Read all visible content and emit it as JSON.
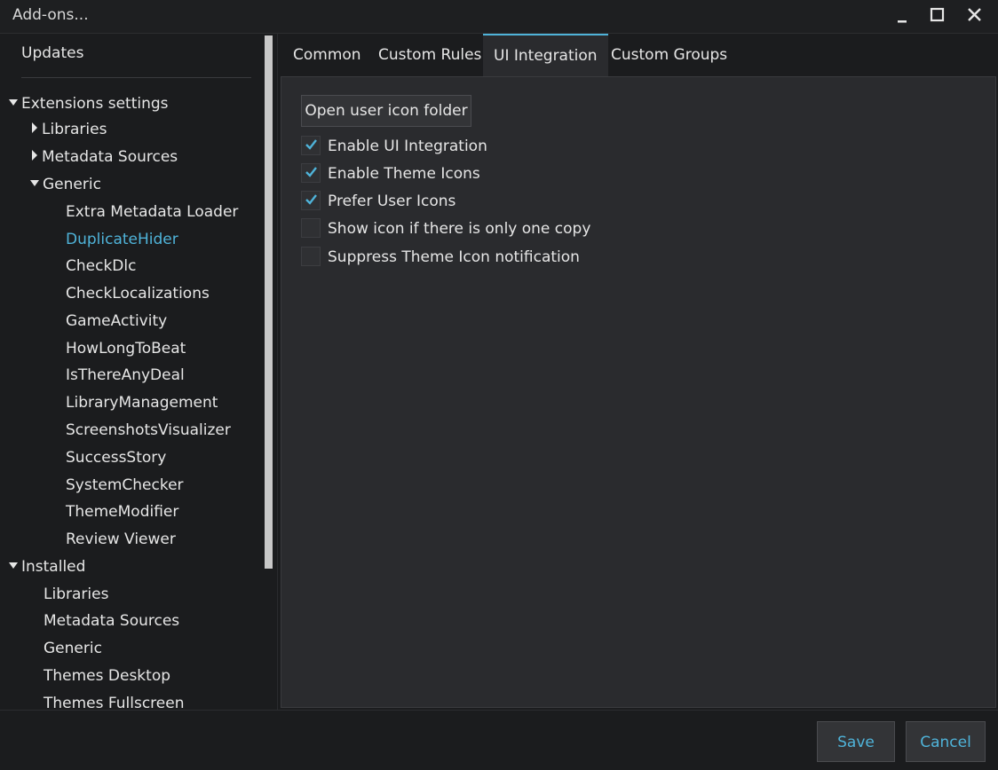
{
  "window": {
    "title": "Add-ons...",
    "controls": [
      "minimize-icon",
      "maximize-icon",
      "close-icon"
    ]
  },
  "sidebar": {
    "updates_label": "Updates",
    "extensions_settings": "Extensions settings",
    "libraries": "Libraries",
    "metadata_sources": "Metadata Sources",
    "generic": "Generic",
    "generic_items": [
      "Extra Metadata Loader",
      "DuplicateHider",
      "CheckDlc",
      "CheckLocalizations",
      "GameActivity",
      "HowLongToBeat",
      "IsThereAnyDeal",
      "LibraryManagement",
      "ScreenshotsVisualizer",
      "SuccessStory",
      "SystemChecker",
      "ThemeModifier",
      "Review Viewer"
    ],
    "active_item": "DuplicateHider",
    "installed": "Installed",
    "installed_items": [
      "Libraries",
      "Metadata Sources",
      "Generic",
      "Themes Desktop",
      "Themes Fullscreen"
    ]
  },
  "tabs": {
    "items": [
      "Common",
      "Custom Rules",
      "UI Integration",
      "Custom Groups"
    ],
    "selected": "UI Integration"
  },
  "content": {
    "open_folder_label": "Open user icon folder",
    "checkboxes": [
      {
        "label": "Enable UI Integration",
        "checked": true
      },
      {
        "label": "Enable Theme Icons",
        "checked": true
      },
      {
        "label": "Prefer User Icons",
        "checked": true
      },
      {
        "label": "Show icon if there is only one copy",
        "checked": false
      },
      {
        "label": "Suppress Theme Icon notification",
        "checked": false
      }
    ]
  },
  "footer": {
    "save_label": "Save",
    "cancel_label": "Cancel"
  },
  "colors": {
    "accent": "#4fb3d9",
    "background": "#1b1c1e",
    "panel": "#2a2b2e"
  }
}
